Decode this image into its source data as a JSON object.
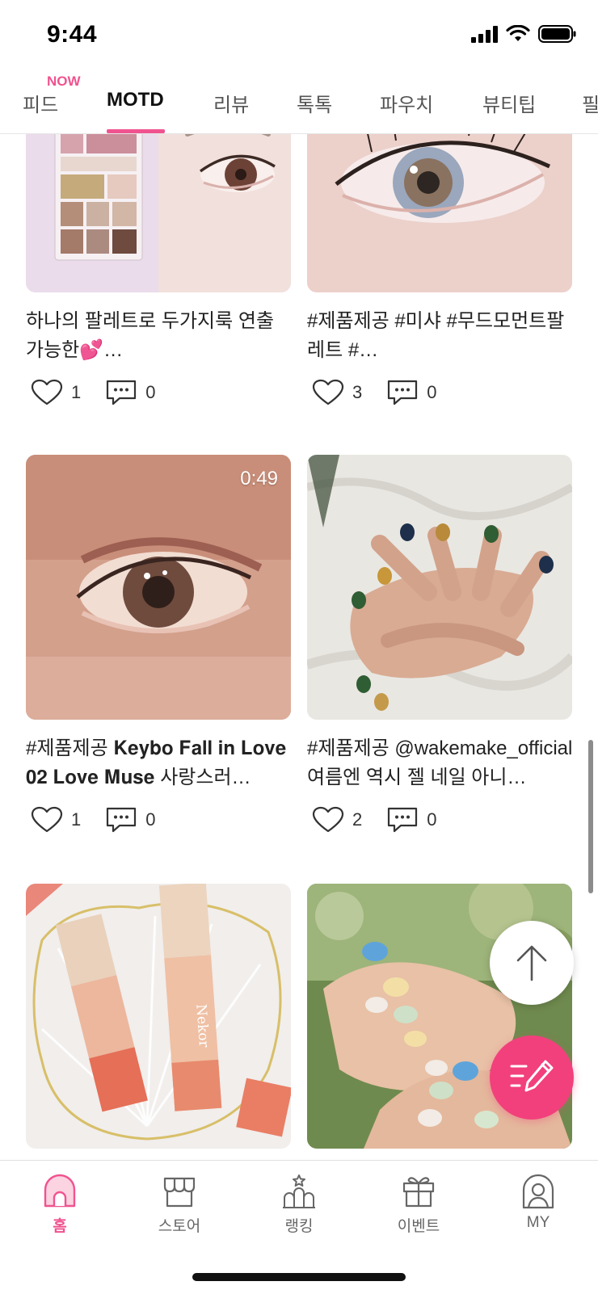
{
  "status_bar": {
    "time": "9:44"
  },
  "tabs": [
    {
      "label": "피드"
    },
    {
      "label": "MOTD",
      "active": true
    },
    {
      "label": "리뷰"
    },
    {
      "label": "톡톡"
    },
    {
      "label": "파우치"
    },
    {
      "label": "뷰티팁"
    },
    {
      "label": "필"
    }
  ],
  "now_badge": "NOW",
  "feed": [
    {
      "caption": "하나의 팔레트로 두가지룩 연출 가능한💕…",
      "likes": "1",
      "comments": "0"
    },
    {
      "caption": "#제품제공 #미샤 #무드모먼트팔레트 #…",
      "likes": "3",
      "comments": "0"
    },
    {
      "caption": "#제품제공 𝐊𝐞𝐲𝐛𝐨 𝐅𝐚𝐥𝐥 𝐢𝐧 𝐋𝐨𝐯𝐞 𝟎𝟐 𝐋𝐨𝐯𝐞 𝐌𝐮𝐬𝐞 사랑스러…",
      "likes": "1",
      "comments": "0",
      "video_duration": "0:49"
    },
    {
      "caption": "#제품제공 @wakemake_official 여름엔 역시 젤 네일 아니…",
      "likes": "2",
      "comments": "0"
    }
  ],
  "product_logo": "Nekor",
  "bottom_nav": [
    {
      "label": "홈",
      "icon": "home-icon",
      "active": true
    },
    {
      "label": "스토어",
      "icon": "store-icon"
    },
    {
      "label": "랭킹",
      "icon": "ranking-icon"
    },
    {
      "label": "이벤트",
      "icon": "gift-icon"
    },
    {
      "label": "MY",
      "icon": "profile-icon"
    }
  ],
  "colors": {
    "accent": "#f0538f",
    "fab": "#f2407c",
    "text": "#222222",
    "muted": "#666666"
  }
}
